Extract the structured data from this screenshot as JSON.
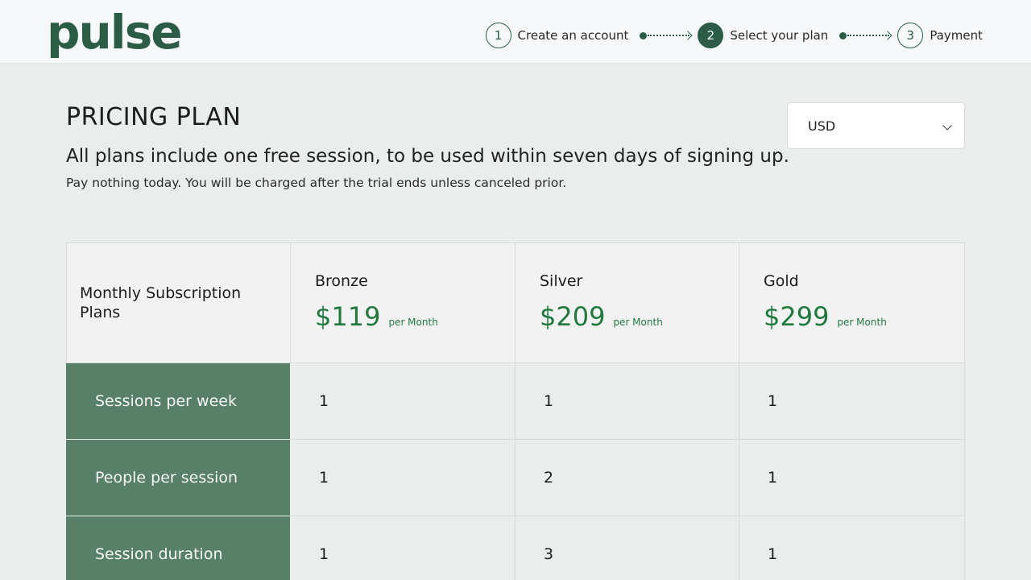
{
  "header": {
    "logo": "pulse",
    "steps": [
      {
        "number": "1",
        "label": "Create an account",
        "active": false
      },
      {
        "number": "2",
        "label": "Select your plan",
        "active": true
      },
      {
        "number": "3",
        "label": "Payment",
        "active": false
      }
    ]
  },
  "main": {
    "title": "PRICING PLAN",
    "subtitle": "All plans include one free session, to be used within seven days of signing up.",
    "note": "Pay nothing today. You will be charged after the trial ends unless canceled prior.",
    "currency": {
      "selected": "USD"
    }
  },
  "table": {
    "header_label": "Monthly Subscription Plans",
    "plans": [
      {
        "name": "Bronze",
        "price": "$119",
        "period": "per Month"
      },
      {
        "name": "Silver",
        "price": "$209",
        "period": "per Month"
      },
      {
        "name": "Gold",
        "price": "$299",
        "period": "per Month"
      }
    ],
    "rows": [
      {
        "label": "Sessions per week",
        "values": [
          "1",
          "1",
          "1"
        ]
      },
      {
        "label": "People per session",
        "values": [
          "1",
          "2",
          "1"
        ]
      },
      {
        "label": "Session duration",
        "values": [
          "1",
          "3",
          "1"
        ]
      }
    ]
  },
  "colors": {
    "brand": "#2b5d46",
    "price": "#1f7a3e",
    "row_label_bg": "#588069",
    "page_bg": "#e9edeb"
  }
}
